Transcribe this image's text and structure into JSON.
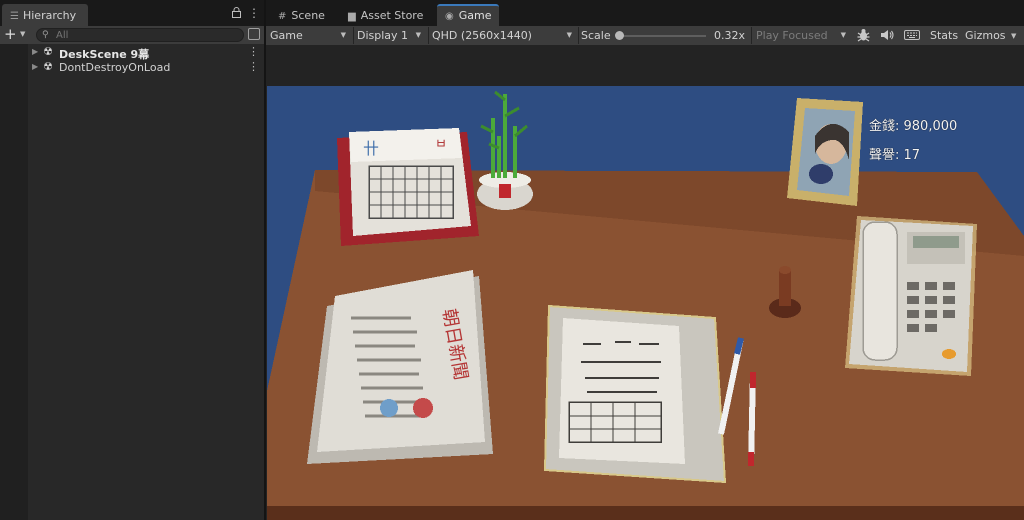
{
  "hierarchy": {
    "tab_label": "Hierarchy",
    "search_placeholder": "All",
    "items": [
      {
        "label": "DeskScene 9幕"
      },
      {
        "label": "DontDestroyOnLoad"
      }
    ]
  },
  "editor_tabs": [
    {
      "label": "Scene"
    },
    {
      "label": "Asset Store"
    },
    {
      "label": "Game"
    }
  ],
  "game_toolbar": {
    "view_mode": "Game",
    "display": "Display 1",
    "resolution": "QHD (2560x1440)",
    "scale_label": "Scale",
    "scale_value": "0.32x",
    "play_mode": "Play Focused",
    "stats_label": "Stats",
    "gizmos_label": "Gizmos"
  },
  "game_hud": {
    "money": "金錢: 980,000",
    "reputation": "聲譽: 17"
  },
  "icons": [
    "hierarchy-list-icon",
    "lock-icon",
    "kebab-menu-icon",
    "plus-icon",
    "search-icon",
    "filter-icon",
    "unity-scene-icon",
    "scene-grid-icon",
    "shopping-bag-icon",
    "gamepad-icon",
    "bug-icon",
    "speaker-icon",
    "keyboard-icon"
  ],
  "colors": {
    "accent": "#3a79bb",
    "wall": "#2e4d82",
    "desk": "#8a5232",
    "panel": "#282828",
    "toolbar": "#3c3c3c"
  }
}
